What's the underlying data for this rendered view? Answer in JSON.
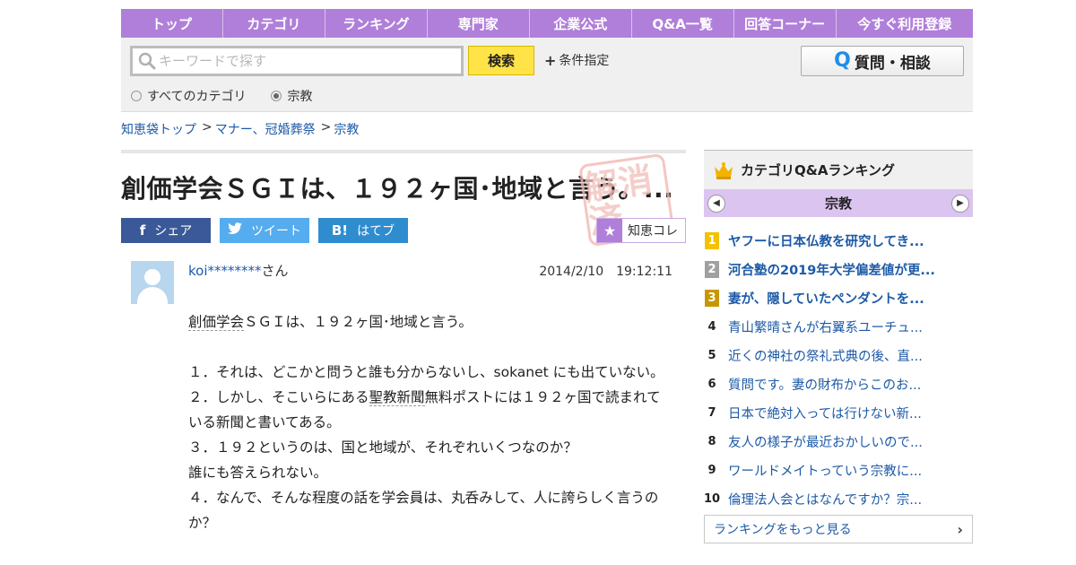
{
  "nav": {
    "items": [
      "トップ",
      "カテゴリ",
      "ランキング",
      "専門家",
      "企業公式",
      "Q&A一覧",
      "回答コーナー",
      "今すぐ利用登録"
    ]
  },
  "search": {
    "placeholder": "キーワードで探す",
    "button": "検索",
    "conditions": "条件指定",
    "ask_button": "質問・相談",
    "radio_all": "すべてのカテゴリ",
    "radio_current": "宗教",
    "selected": "宗教"
  },
  "breadcrumb": {
    "items": [
      "知恵袋トップ",
      "マナー、冠婚葬祭",
      "宗教"
    ],
    "sep": ">"
  },
  "question": {
    "title": "創価学会ＳＧＩは、１９２ヶ国･地域と言う。...",
    "stamp_text": "解消済",
    "share": {
      "facebook": "シェア",
      "twitter": "ツイート",
      "hatena": "はてブ"
    },
    "save_label": "知恵コレ",
    "user": "koi********",
    "user_suffix": "さん",
    "date": "2014/2/10　19:12:11",
    "body": {
      "l1_pre": "",
      "l1_link": "創価学会",
      "l1_post": "ＳＧＩは、１９２ヶ国･地域と言う。",
      "l2": "１．それは、どこかと問うと誰も分からないし、sokanet にも出ていない。",
      "l3_pre": "２．しかし、そこいらにある",
      "l3_link": "聖教新聞",
      "l3_post": "無料ポストには１９２ヶ国で読まれている新聞と書いてある。",
      "l4": "３．１９２というのは、国と地域が、それぞれいくつなのか？",
      "l5": "誰にも答えられない。",
      "l6": "４．なんで、そんな程度の話を学会員は、丸呑みして、人に誇らしく言うのか？"
    }
  },
  "sidebar": {
    "title": "カテゴリQ&Aランキング",
    "category": "宗教",
    "ranking": [
      {
        "rank": "1",
        "text": "ヤフーに日本仏教を研究してき..."
      },
      {
        "rank": "2",
        "text": "河合塾の2019年大学偏差値が更..."
      },
      {
        "rank": "3",
        "text": "妻が、隠していたペンダントを..."
      },
      {
        "rank": "4",
        "text": "青山繁晴さんが右翼系ユーチュ..."
      },
      {
        "rank": "5",
        "text": "近くの神社の祭礼式典の後、直..."
      },
      {
        "rank": "6",
        "text": "質問です。妻の財布からこのお..."
      },
      {
        "rank": "7",
        "text": "日本で絶対入っては行けない新..."
      },
      {
        "rank": "8",
        "text": "友人の様子が最近おかしいので..."
      },
      {
        "rank": "9",
        "text": "ワールドメイトっていう宗教に..."
      },
      {
        "rank": "10",
        "text": "倫理法人会とはなんですか？宗..."
      }
    ],
    "more": "ランキングをもっと見る"
  },
  "colors": {
    "nav_bg": "#b07fd9",
    "search_button": "#ffe347",
    "link": "#1d5aa7",
    "facebook": "#3b5998",
    "twitter": "#55acee",
    "hatena": "#2f8ccf"
  }
}
